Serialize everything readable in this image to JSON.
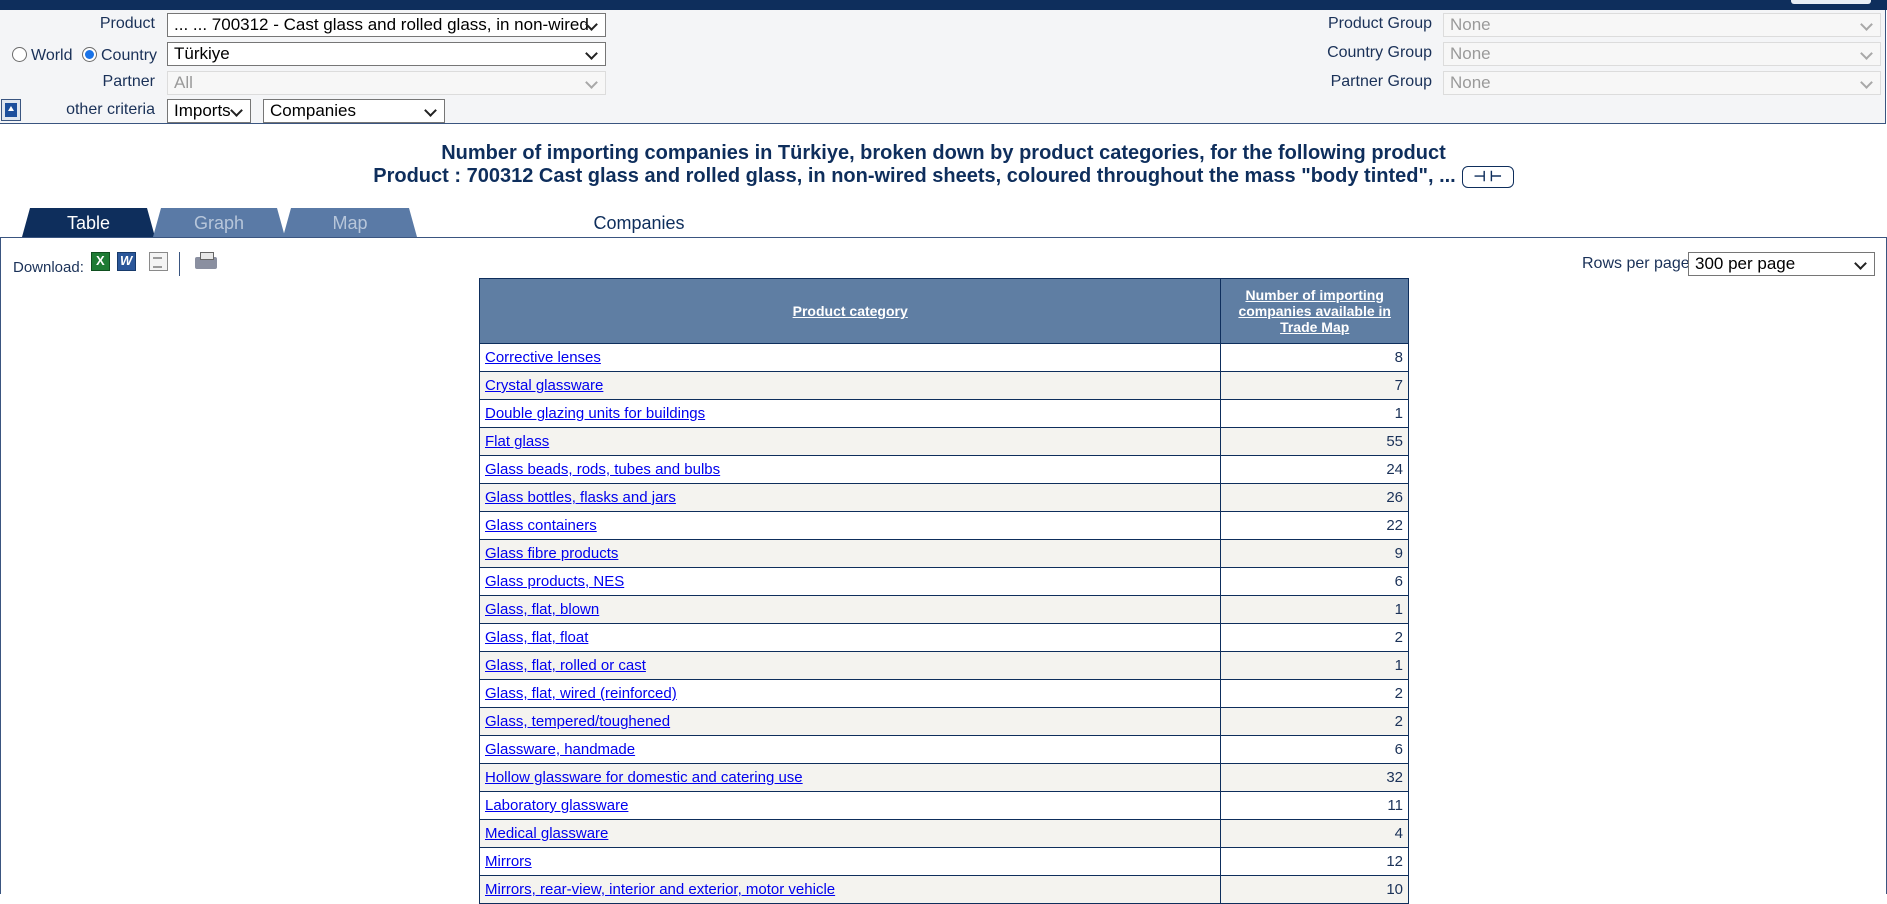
{
  "criteria": {
    "product_label": "Product",
    "product_value": "... ... 700312 - Cast glass and rolled glass, in non-wired",
    "world_label": "World",
    "country_label": "Country",
    "country_value": "Türkiye",
    "partner_label": "Partner",
    "partner_value": "All",
    "other_criteria_label": "other criteria",
    "flow_value": "Imports",
    "measure_value": "Companies",
    "product_group_label": "Product Group",
    "product_group_value": "None",
    "country_group_label": "Country Group",
    "country_group_value": "None",
    "partner_group_label": "Partner Group",
    "partner_group_value": "None"
  },
  "title": {
    "line1": "Number of importing companies in Türkiye, broken down by product categories, for the following product",
    "line2": "Product : 700312 Cast glass and rolled glass, in non-wired sheets, coloured throughout the mass \"body tinted\", ...",
    "nav_arrows": "⊣ ⊢"
  },
  "tabs": {
    "table": "Table",
    "graph": "Graph",
    "map": "Map",
    "companies": "Companies"
  },
  "toolbar": {
    "download_label": "Download:",
    "rows_label": "Rows per page",
    "rows_value": "300 per page"
  },
  "table": {
    "col_category": "Product category",
    "col_count": "Number of importing companies available in Trade Map",
    "rows": [
      {
        "category": "Corrective lenses",
        "count": "8"
      },
      {
        "category": "Crystal glassware",
        "count": "7"
      },
      {
        "category": "Double glazing units for buildings",
        "count": "1"
      },
      {
        "category": "Flat glass",
        "count": "55"
      },
      {
        "category": "Glass beads, rods, tubes and bulbs",
        "count": "24"
      },
      {
        "category": "Glass bottles, flasks and jars",
        "count": "26"
      },
      {
        "category": "Glass containers",
        "count": "22"
      },
      {
        "category": "Glass fibre products",
        "count": "9"
      },
      {
        "category": "Glass products, NES",
        "count": "6"
      },
      {
        "category": "Glass, flat, blown",
        "count": "1"
      },
      {
        "category": "Glass, flat, float",
        "count": "2"
      },
      {
        "category": "Glass, flat, rolled or cast",
        "count": "1"
      },
      {
        "category": "Glass, flat, wired (reinforced)",
        "count": "2"
      },
      {
        "category": "Glass, tempered/toughened",
        "count": "2"
      },
      {
        "category": "Glassware, handmade",
        "count": "6"
      },
      {
        "category": "Hollow glassware for domestic and catering use",
        "count": "32"
      },
      {
        "category": "Laboratory glassware",
        "count": "11"
      },
      {
        "category": "Medical glassware",
        "count": "4"
      },
      {
        "category": "Mirrors",
        "count": "12"
      },
      {
        "category": "Mirrors, rear-view, interior and exterior, motor vehicle",
        "count": "10"
      }
    ]
  }
}
